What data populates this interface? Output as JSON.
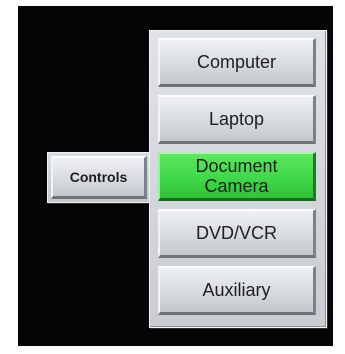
{
  "controls": {
    "label": "Controls"
  },
  "sources": [
    {
      "label": "Computer",
      "active": false
    },
    {
      "label": "Laptop",
      "active": false
    },
    {
      "label": "Document\nCamera",
      "active": true
    },
    {
      "label": "DVD/VCR",
      "active": false
    },
    {
      "label": "Auxiliary",
      "active": false
    }
  ],
  "colors": {
    "active": "#3fd648",
    "button": "#d6d9dd",
    "background": "#050505"
  }
}
